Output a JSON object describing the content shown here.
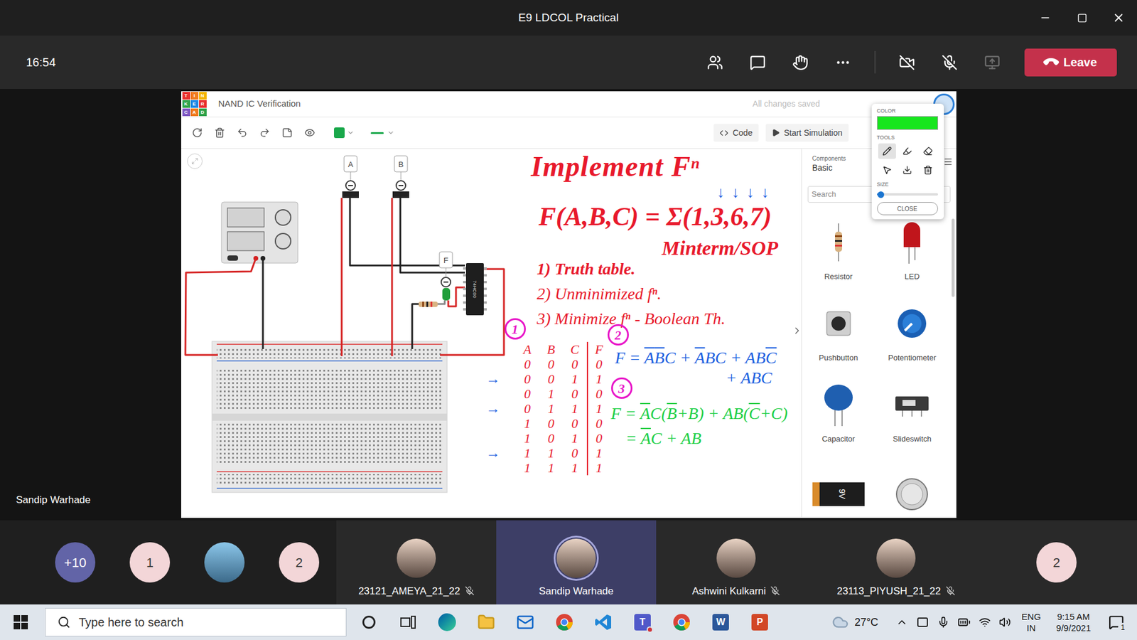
{
  "window": {
    "title": "E9 LDCOL Practical"
  },
  "meeting_bar": {
    "time": "16:54",
    "camera_off": true,
    "mic_off": true,
    "share_disabled": true,
    "leave": "Leave"
  },
  "stage": {
    "presenter_label": "Sandip Warhade"
  },
  "tinkercad": {
    "logo": [
      "T",
      "I",
      "N",
      "K",
      "E",
      "R",
      "C",
      "A",
      "D"
    ],
    "title": "NAND IC Verification",
    "save_status": "All changes saved",
    "shape_color": "#1aa84b",
    "buttons": [
      {
        "label": "Code",
        "kind": "code"
      },
      {
        "label": "Start Simulation",
        "kind": "simulate"
      }
    ],
    "circuit": {
      "switches": [
        "A",
        "B"
      ],
      "led_label": "F",
      "ic_label": "74HC00"
    },
    "panel": {
      "heading": "Components",
      "category": "Basic",
      "search_placeholder": "Search",
      "items": [
        {
          "kind": "resistor",
          "name": "Resistor"
        },
        {
          "kind": "led",
          "name": "LED"
        },
        {
          "kind": "pushbutton",
          "name": "Pushbutton"
        },
        {
          "kind": "potentiometer",
          "name": "Potentiometer"
        },
        {
          "kind": "capacitor",
          "name": "Capacitor"
        },
        {
          "kind": "slideswitch",
          "name": "Slideswitch"
        },
        {
          "kind": "battery",
          "marking": "9V"
        },
        {
          "kind": "coin"
        }
      ]
    },
    "draw_tools": {
      "color_label": "COLOR",
      "color": "#17e61e",
      "tools_label": "TOOLS",
      "tools": [
        {
          "kind": "pen",
          "selected": true
        },
        {
          "kind": "marker",
          "selected": false
        },
        {
          "kind": "eraser",
          "selected": false
        },
        {
          "kind": "pointer",
          "selected": false
        },
        {
          "kind": "download",
          "selected": false
        },
        {
          "kind": "clear",
          "selected": false
        }
      ],
      "size_label": "SIZE",
      "size_level": 0.06,
      "close": "CLOSE"
    }
  },
  "notes": {
    "heading": {
      "text": "Implement F",
      "sup": "n"
    },
    "minterm_arrows": [
      "↓",
      "↓",
      "↓",
      "↓"
    ],
    "function": "F(A,B,C) = Σ(1,3,6,7)",
    "form": "Minterm/SOP",
    "steps": [
      "1) Truth table.",
      "2) Unminimized fⁿ.",
      "3) Minimize fⁿ - Boolean Th."
    ],
    "circles": [
      "1",
      "2",
      "3"
    ],
    "truth_table": {
      "columns": [
        "A",
        "B",
        "C",
        "F"
      ],
      "marker": "→",
      "rows": [
        {
          "cells": [
            "0",
            "0",
            "0",
            "0"
          ],
          "marked": false
        },
        {
          "cells": [
            "0",
            "0",
            "1",
            "1"
          ],
          "marked": true
        },
        {
          "cells": [
            "0",
            "1",
            "0",
            "0"
          ],
          "marked": false
        },
        {
          "cells": [
            "0",
            "1",
            "1",
            "1"
          ],
          "marked": true
        },
        {
          "cells": [
            "1",
            "0",
            "0",
            "0"
          ],
          "marked": false
        },
        {
          "cells": [
            "1",
            "0",
            "1",
            "0"
          ],
          "marked": false
        },
        {
          "cells": [
            "1",
            "1",
            "0",
            "1"
          ],
          "marked": true
        },
        {
          "cells": [
            "1",
            "1",
            "1",
            "1"
          ],
          "marked": false
        }
      ]
    },
    "unminimized": [
      [
        {
          "t": "F = ",
          "bar": false
        },
        {
          "t": "A",
          "bar": true
        },
        {
          "t": "B",
          "bar": true
        },
        {
          "t": "C + ",
          "bar": false
        },
        {
          "t": "A",
          "bar": true
        },
        {
          "t": "BC + AB",
          "bar": false
        },
        {
          "t": "C",
          "bar": true
        }
      ],
      [
        {
          "t": "+ ABC",
          "bar": false
        }
      ]
    ],
    "minimized": [
      [
        {
          "t": "F = ",
          "bar": false
        },
        {
          "t": "A",
          "bar": true
        },
        {
          "t": "C(",
          "bar": false
        },
        {
          "t": "B",
          "bar": true
        },
        {
          "t": "+B) + AB(",
          "bar": false
        },
        {
          "t": "C",
          "bar": true
        },
        {
          "t": "+C)",
          "bar": false
        }
      ],
      [
        {
          "t": "= ",
          "bar": false
        },
        {
          "t": "A",
          "bar": true
        },
        {
          "t": "C + AB",
          "bar": false
        }
      ]
    ]
  },
  "participants": [
    {
      "kind": "count",
      "label": "+10"
    },
    {
      "kind": "initial",
      "label": "1"
    },
    {
      "kind": "photo"
    },
    {
      "kind": "initial",
      "label": "2"
    },
    {
      "kind": "tile",
      "name": "23121_AMEYA_21_22",
      "muted": true,
      "speaking": false
    },
    {
      "kind": "tile",
      "name": "Sandip Warhade",
      "muted": false,
      "speaking": true
    },
    {
      "kind": "tile",
      "name": "Ashwini Kulkarni",
      "muted": true,
      "speaking": false
    },
    {
      "kind": "tile",
      "name": "23113_PIYUSH_21_22",
      "muted": true,
      "speaking": false
    },
    {
      "kind": "initial",
      "label": "2"
    }
  ],
  "taskbar": {
    "search_placeholder": "Type here to search",
    "apps": [
      {
        "kind": "cortana",
        "badge": false
      },
      {
        "kind": "task-view",
        "badge": false
      },
      {
        "kind": "edge",
        "badge": false
      },
      {
        "kind": "explorer",
        "badge": false
      },
      {
        "kind": "mail",
        "badge": false
      },
      {
        "kind": "chrome",
        "badge": false
      },
      {
        "kind": "vscode",
        "badge": false
      },
      {
        "kind": "teams",
        "glyph": "T",
        "badge": true
      },
      {
        "kind": "chrome",
        "badge": false
      },
      {
        "kind": "word",
        "glyph": "W",
        "badge": false
      },
      {
        "kind": "powerpoint",
        "glyph": "P",
        "badge": false
      }
    ],
    "weather": "27°C",
    "language": [
      "ENG",
      "IN"
    ],
    "time": "9:15 AM",
    "date": "9/9/2021",
    "notifications": "1"
  }
}
